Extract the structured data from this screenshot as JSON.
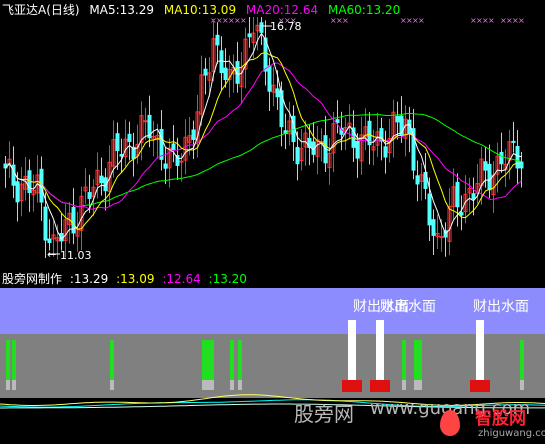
{
  "header": {
    "stock_name": "飞亚达A",
    "period": "(日线)",
    "ma5": "MA5:13.29",
    "ma10": "MA10:13.09",
    "ma20": "MA20:12.64",
    "ma60": "MA60:13.20"
  },
  "chart": {
    "high_label": "16.78",
    "low_label": "11.03"
  },
  "indicator": {
    "name": "股旁网制作",
    "v1": ":13.29",
    "v2": ":13.09",
    "v3": ":12.64",
    "v4": ":13.20",
    "signal_label_1": "财出水面",
    "signal_label_2": "财出水面",
    "signal_label_3": "财出水面"
  },
  "watermark": {
    "brand": "股旁网",
    "domain": "www.guoang.com",
    "site": "智股网",
    "site_url": "zhiguwang.com"
  },
  "colors": {
    "ma5": "#ffffff",
    "ma10": "#ffff00",
    "ma20": "#ff00ff",
    "ma60": "#00ff00",
    "up_candle": "#ff3232",
    "down_candle": "#54ffff",
    "panel_sky": "#8c8cff",
    "panel_ground": "#808080"
  }
}
